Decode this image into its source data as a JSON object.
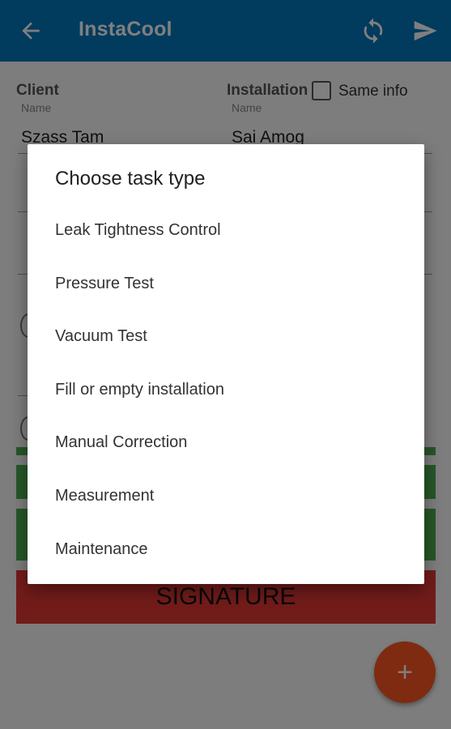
{
  "appbar": {
    "title": "InstaCool",
    "icons": [
      "arrow-back-icon",
      "sync-icon",
      "send-icon"
    ],
    "color": "#0277bd"
  },
  "form": {
    "client_label": "Client",
    "installation_label": "Installation",
    "same_info_label": "Same info",
    "name_caption": "Name",
    "client_name": "Szass Tam",
    "installation_name": "Sai Amog",
    "signature_button": "SIGNATURE",
    "fab_label": "+"
  },
  "dialog": {
    "title": "Choose task type",
    "items": [
      "Leak Tightness Control",
      "Pressure Test",
      "Vacuum Test",
      "Fill or empty installation",
      "Manual Correction",
      "Measurement",
      "Maintenance"
    ]
  },
  "colors": {
    "primary": "#0277bd",
    "accent": "#ff5722",
    "green": "#4caf50",
    "red": "#e53935"
  }
}
